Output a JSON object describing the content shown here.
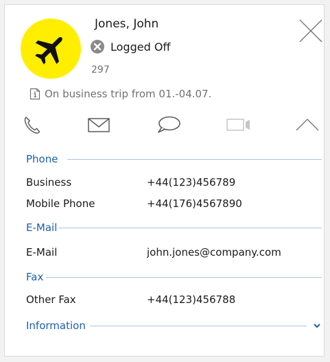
{
  "contact": {
    "name": "Jones, John",
    "status": "Logged Off",
    "extension": "297",
    "info": "On business trip from 01.-04.07.",
    "avatar_icon": "airplane-icon",
    "avatar_color": "#ffee00"
  },
  "actions": {
    "icons": [
      "phone-icon",
      "mail-icon",
      "chat-icon",
      "video-icon",
      "chevron-up-icon"
    ]
  },
  "sections": {
    "phone": {
      "title": "Phone",
      "rows": [
        {
          "label": "Business",
          "value": "+44(123)456789"
        },
        {
          "label": "Mobile Phone",
          "value": "+44(176)4567890"
        }
      ]
    },
    "email": {
      "title": "E-Mail",
      "rows": [
        {
          "label": "E-Mail",
          "value": "john.jones@company.com"
        }
      ]
    },
    "fax": {
      "title": "Fax",
      "rows": [
        {
          "label": "Other Fax",
          "value": "+44(123)456788"
        }
      ]
    },
    "information": {
      "title": "Information"
    }
  },
  "colors": {
    "accent": "#1c5fae",
    "status_offline": "#8a8a8a",
    "icon_gray": "#5a5a5a"
  }
}
